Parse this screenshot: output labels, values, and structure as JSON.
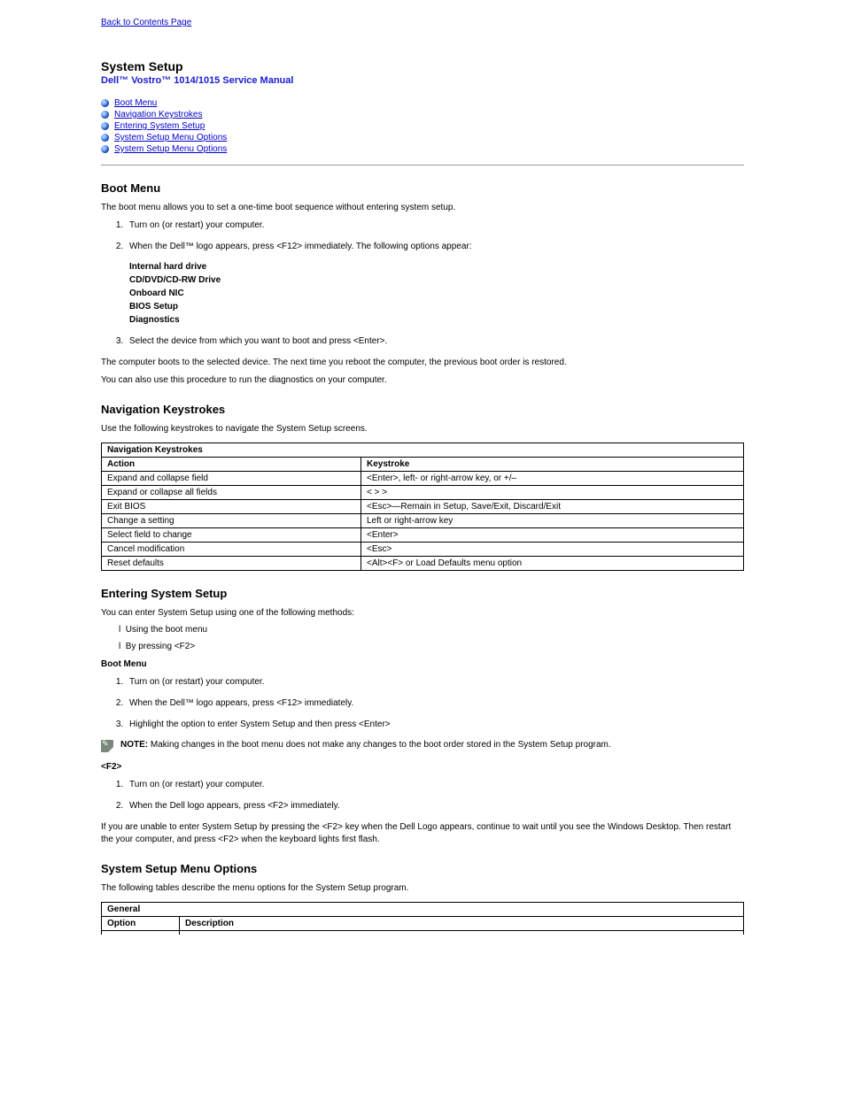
{
  "back_link": "Back to Contents Page",
  "page_title": "System Setup",
  "subtitle": "Dell™ Vostro™ 1014/1015 Service Manual",
  "toc": [
    {
      "label": "Boot Menu"
    },
    {
      "label": "Navigation Keystrokes"
    },
    {
      "label": "Entering System Setup"
    },
    {
      "label": "System Setup Menu Options"
    },
    {
      "label": "System Setup Menu Options"
    }
  ],
  "boot": {
    "heading": "Boot Menu",
    "p1": "The boot menu allows you to set a one-time boot sequence without entering system setup.",
    "step1": "Turn on (or restart) your computer.",
    "step2_lead": "When the Dell™ logo appears, press <F12> immediately. The following options appear:",
    "opts": [
      "Internal  hard drive",
      "CD/DVD/CD-RW Drive",
      "Onboard NIC",
      "BIOS Setup",
      "Diagnostics"
    ],
    "step3": "Select the device from which you want to boot and press <Enter>.",
    "p_after": "The computer boots to the selected device. The next time you reboot the computer, the previous boot order is restored.",
    "p_proc": "You can also use this procedure to run the diagnostics on your computer."
  },
  "nav": {
    "heading": "Navigation Keystrokes",
    "intro": "Use the following keystrokes to navigate the System Setup screens.",
    "table_header": "Navigation Keystrokes",
    "rows": [
      {
        "a": "Action",
        "b": "Keystroke"
      },
      {
        "a": "Expand and collapse field",
        "b": "<Enter>, left- or right-arrow key, or +/–"
      },
      {
        "a": "Expand or collapse all fields",
        "b": "< > >"
      },
      {
        "a": "Exit BIOS",
        "b": "<Esc>—Remain in Setup, Save/Exit, Discard/Exit"
      },
      {
        "a": "Change a setting",
        "b": "Left or right-arrow key"
      },
      {
        "a": "Select field to change",
        "b": "<Enter>"
      },
      {
        "a": "Cancel modification",
        "b": "<Esc>"
      },
      {
        "a": "Reset defaults",
        "b": "<Alt><F> or Load Defaults menu option"
      }
    ]
  },
  "enter": {
    "heading": "Entering System Setup",
    "intro": "You can enter System Setup using one of the following methods:",
    "bullets": [
      "Using the boot menu",
      "By pressing <F2>"
    ],
    "sub_bootmenu": "Boot Menu",
    "s1": "Turn on (or restart) your computer.",
    "s2": "When the Dell™ logo appears, press <F12> immediately.",
    "s3": "Highlight the option to enter System Setup and then press <Enter>",
    "note_label": "NOTE:",
    "note_text": " Making changes in the boot menu does not make any changes to the boot order stored in the System Setup program.",
    "sub_f2": "<F2>",
    "f2_s1": "Turn on (or restart) your computer.",
    "f2_s2": "When the Dell logo appears, press <F2> immediately.",
    "f2_p": "If you are unable to enter System Setup by pressing the <F2> key when the Dell Logo appears, continue to wait until you see the Windows Desktop. Then restart the your computer, and press <F2> when the keyboard lights first flash."
  },
  "menu": {
    "heading": "System Setup Menu Options",
    "intro": "The following tables describe the menu options for the System Setup program.",
    "general_header": "General",
    "col_option": "Option",
    "col_desc": "Description"
  }
}
